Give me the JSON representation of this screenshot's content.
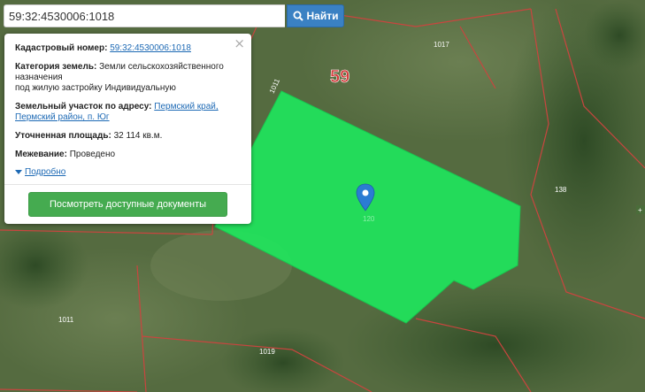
{
  "search": {
    "value": "59:32:4530006:1018",
    "button_label": "Найти"
  },
  "popup": {
    "cadastral_label": "Кадастровый номер:",
    "cadastral_value": "59:32:4530006:1018",
    "category_label": "Категория земель:",
    "category_value": "Земли сельскохозяйственного назначения",
    "category_value_2": "под жилую застройку Индивидуальную",
    "address_label": "Земельный участок по адресу:",
    "address_value_1": "Пермский край,",
    "address_value_2": "Пермский район, п. Юг",
    "area_label": "Уточненная площадь:",
    "area_value": "32 114 кв.м.",
    "survey_label": "Межевание:",
    "survey_value": "Проведено",
    "more_label": "Подробно",
    "docs_button_label": "Посмотреть доступные документы",
    "close_symbol": "×"
  },
  "map": {
    "block_label": "59",
    "parcel_labels": [
      "1017",
      "1011",
      "138",
      "1011",
      "1019",
      "120"
    ],
    "parcel_color": "#1fe55c",
    "boundary_color": "#c9453f",
    "marker_color": "#2b7cd3"
  }
}
